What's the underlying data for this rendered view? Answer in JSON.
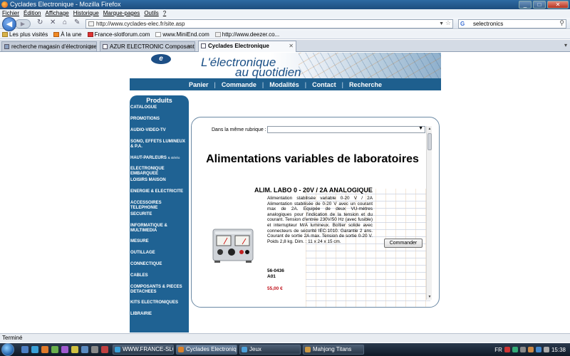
{
  "browser": {
    "window_title": "Cyclades Electronique - Mozilla Firefox",
    "menu": [
      "Fichier",
      "Édition",
      "Affichage",
      "Historique",
      "Marque-pages",
      "Outils",
      "?"
    ],
    "url": "http://www.cyclades-elec.fr/site.asp",
    "search_value": "selectronics",
    "bookmarks": [
      "Les plus visités",
      "À la une",
      "France-slotforum.com",
      "www.MiniEnd.com",
      "http://www.deezer.co..."
    ],
    "tabs": [
      {
        "label": "recherche magasin d'électronique -..."
      },
      {
        "label": "AZUR ELECTRONIC Composants el..."
      },
      {
        "label": "Cyclades Electronique"
      }
    ],
    "status_text": "Terminé"
  },
  "site": {
    "logo": "e",
    "tagline_1": "L'électronique",
    "tagline_2": "au quotidien",
    "nav": [
      "Panier",
      "Commande",
      "Modalités",
      "Contact",
      "Recherche"
    ],
    "sidebar_title": "Produits",
    "categories": [
      "CATALOGUE",
      "PROMOTIONS",
      "AUDIO-VIDEO-TV",
      "SONO, EFFETS LUMINEUX & P.A.",
      "HAUT-PARLEURS",
      "ELECTRONIQUE EMBARQUEE",
      "LOISIRS MAISON",
      "ENERGIE & ELECTRICITE",
      "ACCESSOIRES TELEPHONIE",
      "SECURITE",
      "INFORMATIQUE & MULTIMEDIA",
      "MESURE",
      "OUTILLAGE",
      "CONNECTIQUE",
      "CABLES",
      "COMPOSANTS & PIECES DETACHEES",
      "KITS ELECTRONIQUES",
      "LIBRAIRIE"
    ],
    "hp_suffix": "& stéréo"
  },
  "content": {
    "rubrique_label": "Dans la même rubrique :",
    "rubrique_value": "",
    "heading": "Alimentations variables de laboratoires",
    "product_title": "ALIM. LABO 0 - 20V / 2A ANALOGIQUE",
    "description": "Alimentation stabilisée variable 0-20 V / 2A Alimentation stabilisée de 0-20 V avec un courant max de 2A. Equipée de deux VU-mètres analogiques pour l'indication de la tension et du courant. Tension d'entrée 230V/50 Hz (avec fusible) et interrupteur M/A lumineux. Boîtier solide avec connecteurs de sécurité IEC-1010. Garantie 2 ans. Courant de sortie 2A max. Tension de sortie 0-20 V. Poids 2,8 kg. Dim. : 11 x 24 x 15 cm.",
    "ref_1": "56-0436",
    "ref_2": "A01",
    "price": "55,00 €",
    "order_button": "Commander"
  },
  "taskbar": {
    "tasks": [
      "WWW.FRANCE-SLO...",
      "Cyclades Electroniq...",
      "Jeux",
      "Mahjong Titans"
    ],
    "lang": "FR",
    "clock": "15:38"
  }
}
